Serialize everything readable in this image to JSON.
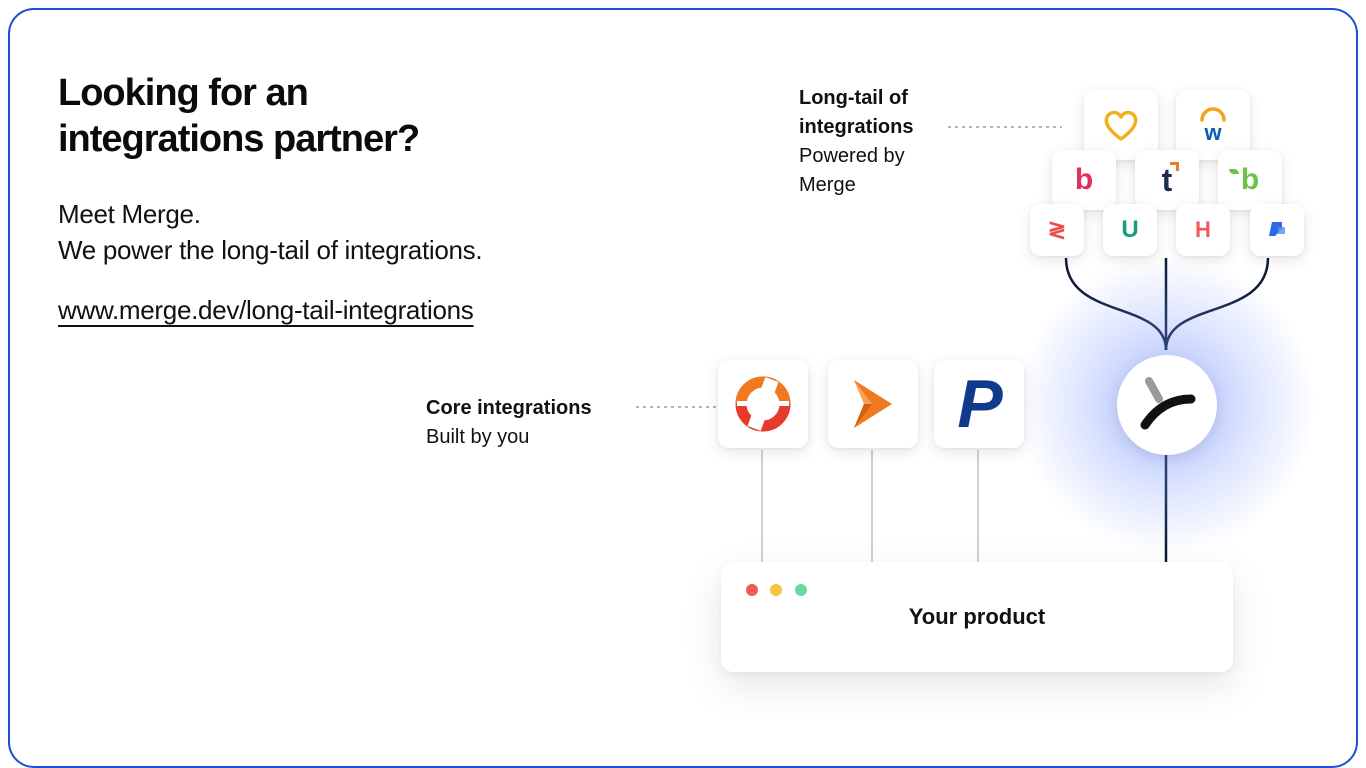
{
  "heading": {
    "line1": "Looking for an",
    "line2": "integrations partner?"
  },
  "subheading": {
    "line1": "Meet Merge.",
    "line2": "We power the long-tail of integrations."
  },
  "link": {
    "text": "www.merge.dev/long-tail-integrations"
  },
  "long_tail_label": {
    "title_line1": "Long-tail of",
    "title_line2": "integrations",
    "sub_line1": "Powered by",
    "sub_line2": "Merge"
  },
  "core_label": {
    "title": "Core integrations",
    "sub": "Built by you"
  },
  "long_tail_tiles": [
    {
      "icon": "heart-icon",
      "color": "#f2b01e"
    },
    {
      "icon": "workday-icon",
      "glyph": "w",
      "color": "#0a5bb8"
    },
    {
      "icon": "bamboo-b-icon",
      "glyph": "b",
      "color": "#e0305e"
    },
    {
      "icon": "t-logo-icon",
      "glyph": "t",
      "color": "#1d2b4f"
    },
    {
      "icon": "leaf-b-icon",
      "glyph": "b",
      "color": "#6cc24a"
    },
    {
      "icon": "zigzag-icon",
      "glyph": "≷",
      "color": "#ee4b4b"
    },
    {
      "icon": "magnet-icon",
      "glyph": "U",
      "color": "#1a9b7a"
    },
    {
      "icon": "h-logo-icon",
      "glyph": "H",
      "color": "#f25a5a"
    },
    {
      "icon": "jira-icon",
      "color": "#2a6ae9"
    }
  ],
  "core_tiles": [
    {
      "icon": "ring-logo-icon",
      "color": "#e83a2a"
    },
    {
      "icon": "arrow-logo-icon",
      "color": "#f07a1f"
    },
    {
      "icon": "paypal-p-icon",
      "glyph": "P",
      "color": "#103b8c"
    }
  ],
  "merge_logo": {
    "icon": "merge-logo-icon"
  },
  "product": {
    "title": "Your product",
    "dots": [
      "#f25a5a",
      "#f7c244",
      "#69d9a0"
    ]
  }
}
